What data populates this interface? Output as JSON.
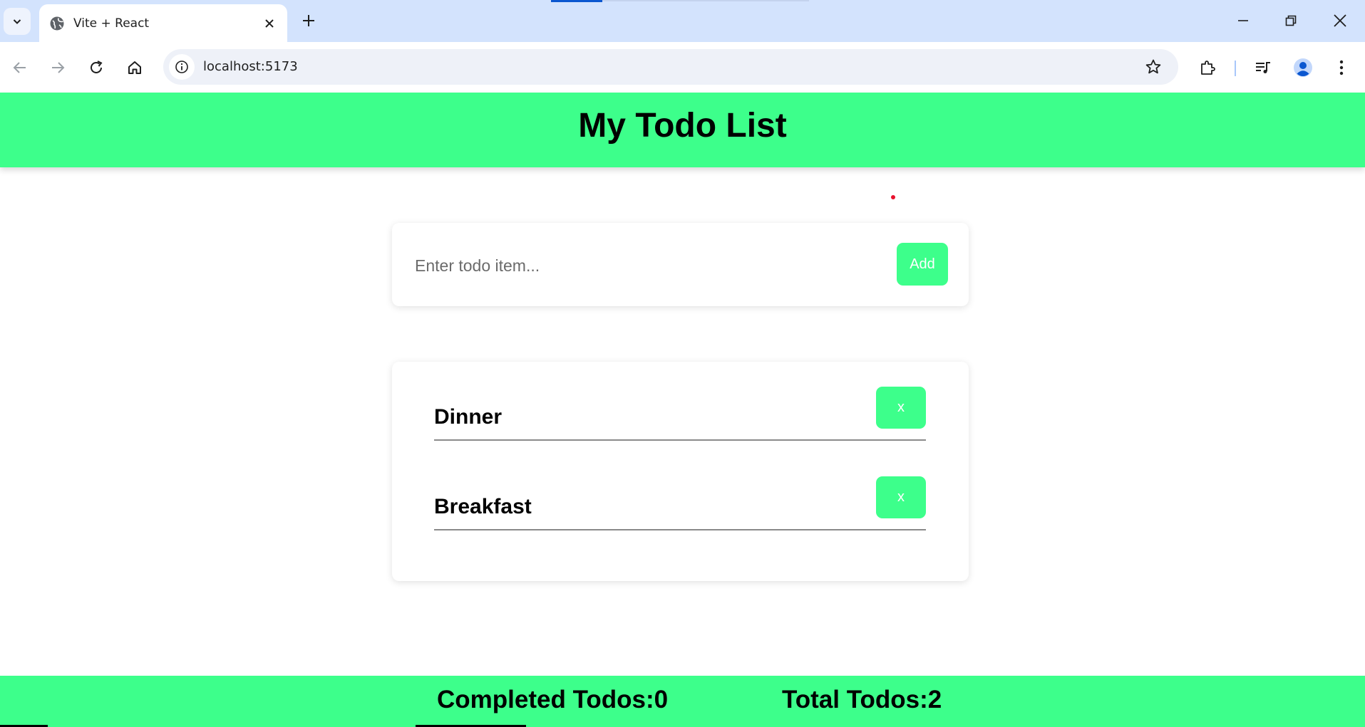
{
  "browser": {
    "tab_title": "Vite + React",
    "url": "localhost:5173"
  },
  "app": {
    "title": "My Todo List",
    "input_placeholder": "Enter todo item...",
    "input_value": "",
    "add_label": "Add",
    "todos": [
      {
        "text": "Dinner",
        "delete_label": "x"
      },
      {
        "text": "Breakfast",
        "delete_label": "x"
      }
    ],
    "footer": {
      "completed": "Completed Todos:0",
      "total": "Total Todos:2"
    }
  },
  "colors": {
    "accent": "#3dff8b",
    "tabstrip": "#d3e3fd",
    "omnibox": "#eef1f8"
  }
}
